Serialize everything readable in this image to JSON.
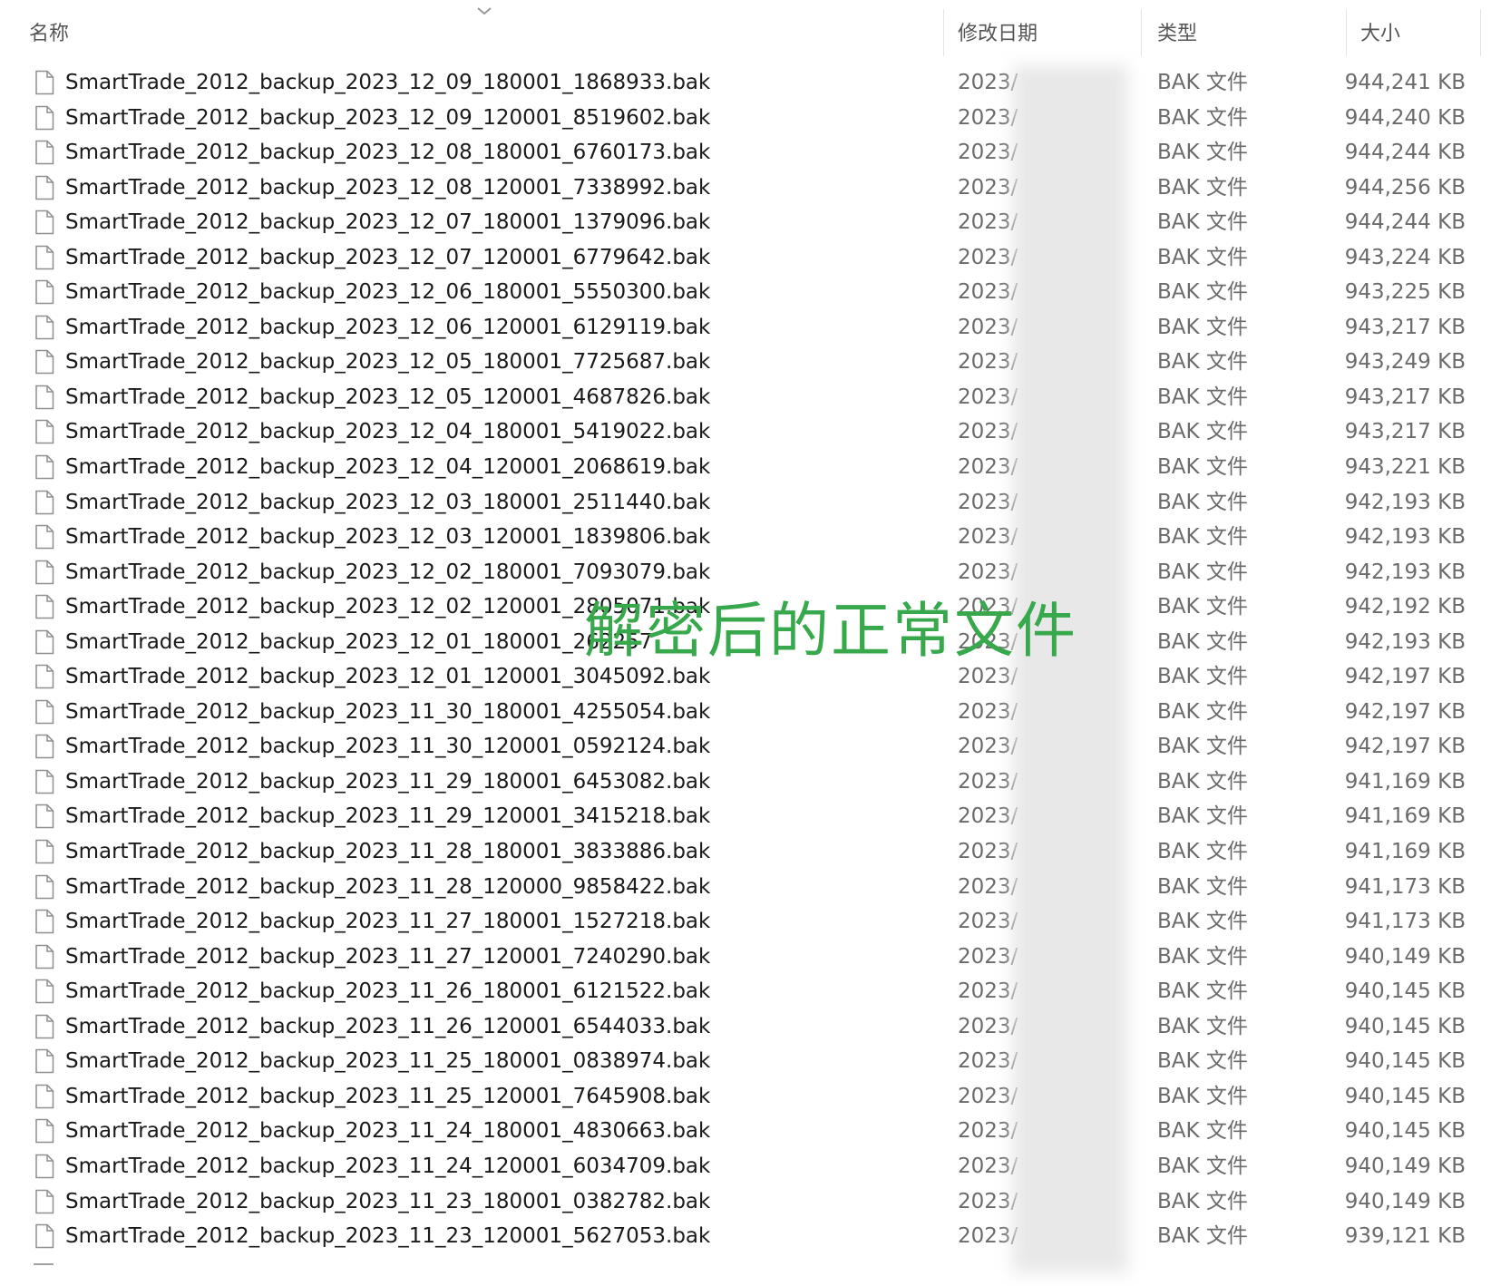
{
  "header": {
    "name_label": "名称",
    "date_label": "修改日期",
    "type_label": "类型",
    "size_label": "大小"
  },
  "overlay": {
    "text": "解密后的正常文件",
    "color": "#38a84c"
  },
  "icons": {
    "file": "file-icon",
    "sort": "chevron-down-icon"
  },
  "files": [
    {
      "name": "SmartTrade_2012_backup_2023_12_09_180001_1868933.bak",
      "date": "2023/",
      "type": "BAK 文件",
      "size": "944,241 KB"
    },
    {
      "name": "SmartTrade_2012_backup_2023_12_09_120001_8519602.bak",
      "date": "2023/",
      "type": "BAK 文件",
      "size": "944,240 KB"
    },
    {
      "name": "SmartTrade_2012_backup_2023_12_08_180001_6760173.bak",
      "date": "2023/",
      "type": "BAK 文件",
      "size": "944,244 KB"
    },
    {
      "name": "SmartTrade_2012_backup_2023_12_08_120001_7338992.bak",
      "date": "2023/",
      "type": "BAK 文件",
      "size": "944,256 KB"
    },
    {
      "name": "SmartTrade_2012_backup_2023_12_07_180001_1379096.bak",
      "date": "2023/",
      "type": "BAK 文件",
      "size": "944,244 KB"
    },
    {
      "name": "SmartTrade_2012_backup_2023_12_07_120001_6779642.bak",
      "date": "2023/",
      "type": "BAK 文件",
      "size": "943,224 KB"
    },
    {
      "name": "SmartTrade_2012_backup_2023_12_06_180001_5550300.bak",
      "date": "2023/",
      "type": "BAK 文件",
      "size": "943,225 KB"
    },
    {
      "name": "SmartTrade_2012_backup_2023_12_06_120001_6129119.bak",
      "date": "2023/",
      "type": "BAK 文件",
      "size": "943,217 KB"
    },
    {
      "name": "SmartTrade_2012_backup_2023_12_05_180001_7725687.bak",
      "date": "2023/",
      "type": "BAK 文件",
      "size": "943,249 KB"
    },
    {
      "name": "SmartTrade_2012_backup_2023_12_05_120001_4687826.bak",
      "date": "2023/",
      "type": "BAK 文件",
      "size": "943,217 KB"
    },
    {
      "name": "SmartTrade_2012_backup_2023_12_04_180001_5419022.bak",
      "date": "2023/",
      "type": "BAK 文件",
      "size": "943,217 KB"
    },
    {
      "name": "SmartTrade_2012_backup_2023_12_04_120001_2068619.bak",
      "date": "2023/",
      "type": "BAK 文件",
      "size": "943,221 KB"
    },
    {
      "name": "SmartTrade_2012_backup_2023_12_03_180001_2511440.bak",
      "date": "2023/",
      "type": "BAK 文件",
      "size": "942,193 KB"
    },
    {
      "name": "SmartTrade_2012_backup_2023_12_03_120001_1839806.bak",
      "date": "2023/",
      "type": "BAK 文件",
      "size": "942,193 KB"
    },
    {
      "name": "SmartTrade_2012_backup_2023_12_02_180001_7093079.bak",
      "date": "2023/",
      "type": "BAK 文件",
      "size": "942,193 KB"
    },
    {
      "name": "SmartTrade_2012_backup_2023_12_02_120001_2805071.bak",
      "date": "2023/",
      "type": "BAK 文件",
      "size": "942,192 KB"
    },
    {
      "name": "SmartTrade_2012_backup_2023_12_01_180001_262257",
      "date": "2023/",
      "type": "BAK 文件",
      "size": "942,193 KB"
    },
    {
      "name": "SmartTrade_2012_backup_2023_12_01_120001_3045092.bak",
      "date": "2023/",
      "type": "BAK 文件",
      "size": "942,197 KB"
    },
    {
      "name": "SmartTrade_2012_backup_2023_11_30_180001_4255054.bak",
      "date": "2023/",
      "type": "BAK 文件",
      "size": "942,197 KB"
    },
    {
      "name": "SmartTrade_2012_backup_2023_11_30_120001_0592124.bak",
      "date": "2023/",
      "type": "BAK 文件",
      "size": "942,197 KB"
    },
    {
      "name": "SmartTrade_2012_backup_2023_11_29_180001_6453082.bak",
      "date": "2023/",
      "type": "BAK 文件",
      "size": "941,169 KB"
    },
    {
      "name": "SmartTrade_2012_backup_2023_11_29_120001_3415218.bak",
      "date": "2023/",
      "type": "BAK 文件",
      "size": "941,169 KB"
    },
    {
      "name": "SmartTrade_2012_backup_2023_11_28_180001_3833886.bak",
      "date": "2023/",
      "type": "BAK 文件",
      "size": "941,169 KB"
    },
    {
      "name": "SmartTrade_2012_backup_2023_11_28_120000_9858422.bak",
      "date": "2023/",
      "type": "BAK 文件",
      "size": "941,173 KB"
    },
    {
      "name": "SmartTrade_2012_backup_2023_11_27_180001_1527218.bak",
      "date": "2023/",
      "type": "BAK 文件",
      "size": "941,173 KB"
    },
    {
      "name": "SmartTrade_2012_backup_2023_11_27_120001_7240290.bak",
      "date": "2023/",
      "type": "BAK 文件",
      "size": "940,149 KB"
    },
    {
      "name": "SmartTrade_2012_backup_2023_11_26_180001_6121522.bak",
      "date": "2023/",
      "type": "BAK 文件",
      "size": "940,145 KB"
    },
    {
      "name": "SmartTrade_2012_backup_2023_11_26_120001_6544033.bak",
      "date": "2023/",
      "type": "BAK 文件",
      "size": "940,145 KB"
    },
    {
      "name": "SmartTrade_2012_backup_2023_11_25_180001_0838974.bak",
      "date": "2023/",
      "type": "BAK 文件",
      "size": "940,145 KB"
    },
    {
      "name": "SmartTrade_2012_backup_2023_11_25_120001_7645908.bak",
      "date": "2023/",
      "type": "BAK 文件",
      "size": "940,145 KB"
    },
    {
      "name": "SmartTrade_2012_backup_2023_11_24_180001_4830663.bak",
      "date": "2023/",
      "type": "BAK 文件",
      "size": "940,145 KB"
    },
    {
      "name": "SmartTrade_2012_backup_2023_11_24_120001_6034709.bak",
      "date": "2023/",
      "type": "BAK 文件",
      "size": "940,149 KB"
    },
    {
      "name": "SmartTrade_2012_backup_2023_11_23_180001_0382782.bak",
      "date": "2023/",
      "type": "BAK 文件",
      "size": "940,149 KB"
    },
    {
      "name": "SmartTrade_2012_backup_2023_11_23_120001_5627053.bak",
      "date": "2023/",
      "type": "BAK 文件",
      "size": "939,121 KB"
    }
  ]
}
